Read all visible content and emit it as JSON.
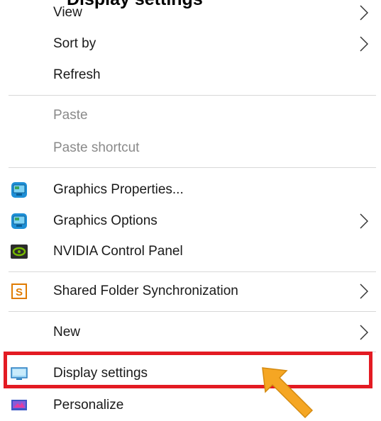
{
  "title_peek": "Display settings",
  "menu": {
    "group1": [
      {
        "label": "View",
        "submenu": true
      },
      {
        "label": "Sort by",
        "submenu": true
      },
      {
        "label": "Refresh",
        "submenu": false
      }
    ],
    "group2": [
      {
        "label": "Paste",
        "disabled": true
      },
      {
        "label": "Paste shortcut",
        "disabled": true
      }
    ],
    "group3": [
      {
        "label": "Graphics Properties...",
        "icon": "intel-graphics-icon"
      },
      {
        "label": "Graphics Options",
        "icon": "intel-graphics-icon",
        "submenu": true
      },
      {
        "label": "NVIDIA Control Panel",
        "icon": "nvidia-icon"
      }
    ],
    "group4": [
      {
        "label": "Shared Folder Synchronization",
        "icon": "shared-folder-icon",
        "submenu": true
      }
    ],
    "group5": [
      {
        "label": "New",
        "submenu": true
      }
    ],
    "group6": [
      {
        "label": "Display settings",
        "icon": "display-icon",
        "highlighted": true
      },
      {
        "label": "Personalize",
        "icon": "personalize-icon"
      }
    ]
  },
  "colors": {
    "highlight_border": "#e31b23",
    "arrow": "#f5a623",
    "separator": "#d8d8d8",
    "disabled_text": "#8a8a8a"
  }
}
